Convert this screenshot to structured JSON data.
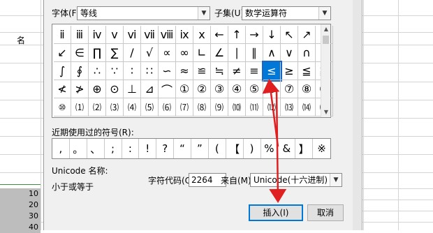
{
  "sheet": {
    "header_name": "名",
    "rows": [
      "10",
      "20",
      "30",
      "40"
    ]
  },
  "dialog": {
    "font_label": "字体(F):",
    "font_value": "等线",
    "subset_label": "子集(U):",
    "subset_value": "数学运算符",
    "symbol_grid": [
      [
        "ⅱ",
        "ⅲ",
        "ⅳ",
        "ⅴ",
        "ⅵ",
        "ⅶ",
        "ⅷ",
        "ⅸ",
        "ⅹ",
        "←",
        "↑",
        "→",
        "↓",
        "↖",
        "↗",
        "↘"
      ],
      [
        "↙",
        "∈",
        "∏",
        "∑",
        "∕",
        "√",
        "∝",
        "∞",
        "∟",
        "∠",
        "∣",
        "∥",
        "∧",
        "∨",
        "∩",
        "∪"
      ],
      [
        "∫",
        "∮",
        "∴",
        "∵",
        "∶",
        "∷",
        "∽",
        "≈",
        "≌",
        "≒",
        "≠",
        "≡",
        "≤",
        "≥",
        "≦",
        "≧"
      ],
      [
        "≮",
        "≯",
        "⊕",
        "⊙",
        "⊥",
        "⊿",
        "⌒",
        "①",
        "②",
        "③",
        "④",
        "⑤",
        "⑥",
        "⑦",
        "⑧",
        "⑨"
      ],
      [
        "⑩",
        "⑴",
        "⑵",
        "⑶",
        "⑷",
        "⑸",
        "⑹",
        "⑺",
        "⑻",
        "⑼",
        "⑽",
        "⑾",
        "⑿",
        "⒀",
        "⒁",
        "⒂"
      ]
    ],
    "selected_symbol": "≤",
    "recent_label": "近期使用过的符号(R):",
    "recent_symbols": [
      ",",
      "。",
      "、",
      ";",
      ":",
      "!",
      "?",
      "“",
      "”",
      "(",
      "【",
      ")",
      "%",
      "&",
      "】",
      "※"
    ],
    "unicode_name_label": "Unicode 名称:",
    "unicode_name_value": "小于或等于",
    "char_code_label": "字符代码(C):",
    "char_code_value": "2264",
    "from_label": "来自(M):",
    "from_value": "Unicode(十六进制)",
    "insert_button": "插入(I)",
    "cancel_button": "取消"
  },
  "colors": {
    "selection": "#0078d7",
    "annotation_arrow": "#e02020"
  }
}
